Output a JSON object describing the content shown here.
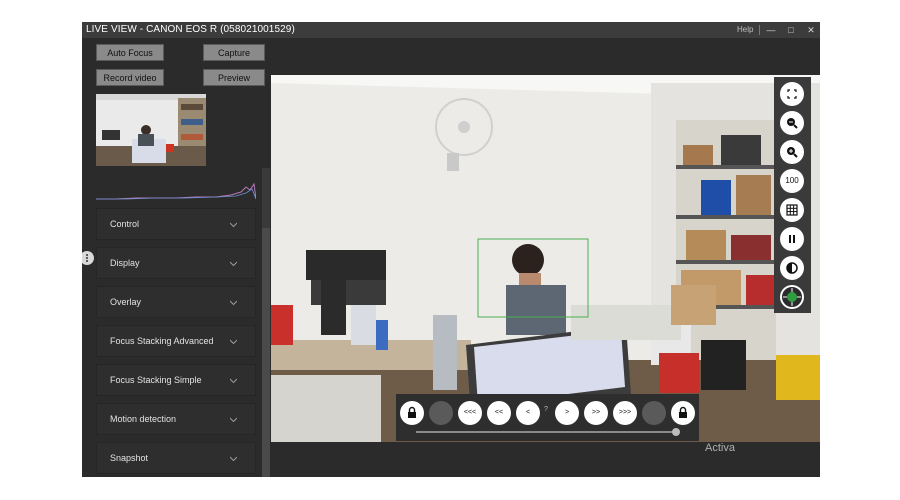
{
  "window": {
    "title": "LIVE VIEW - CANON EOS R (058021001529)",
    "help_label": "Help",
    "minimize_icon": "minimize-icon",
    "maximize_icon": "maximize-icon",
    "close_icon": "close-icon"
  },
  "actions": {
    "auto_focus": "Auto Focus",
    "capture": "Capture",
    "record_video": "Record video",
    "preview": "Preview"
  },
  "panels": [
    {
      "label": "Control"
    },
    {
      "label": "Display"
    },
    {
      "label": "Overlay"
    },
    {
      "label": "Focus Stacking Advanced"
    },
    {
      "label": "Focus Stacking Simple"
    },
    {
      "label": "Motion detection"
    },
    {
      "label": "Snapshot"
    }
  ],
  "toolbar": {
    "zoom_level_label": "100",
    "icons": [
      "fullscreen-icon",
      "zoom-out-icon",
      "zoom-in-icon",
      "zoom-100-icon",
      "grid-icon",
      "pause-icon",
      "exposure-icon",
      "focus-target-icon"
    ]
  },
  "nav": {
    "lock_left_icon": "lock-icon",
    "back_far": "<<<",
    "back_mid": "<<",
    "back": "<",
    "step": "?",
    "forward": ">",
    "forward_mid": ">>",
    "forward_far": ">>>",
    "lock_right_icon": "lock-icon"
  },
  "colors": {
    "window_bg": "#2b2b2b",
    "titlebar_bg": "#3c3c3c",
    "button_bg": "#8a8a8a",
    "focus_box": "#4caf50"
  },
  "watermark": "Activa"
}
